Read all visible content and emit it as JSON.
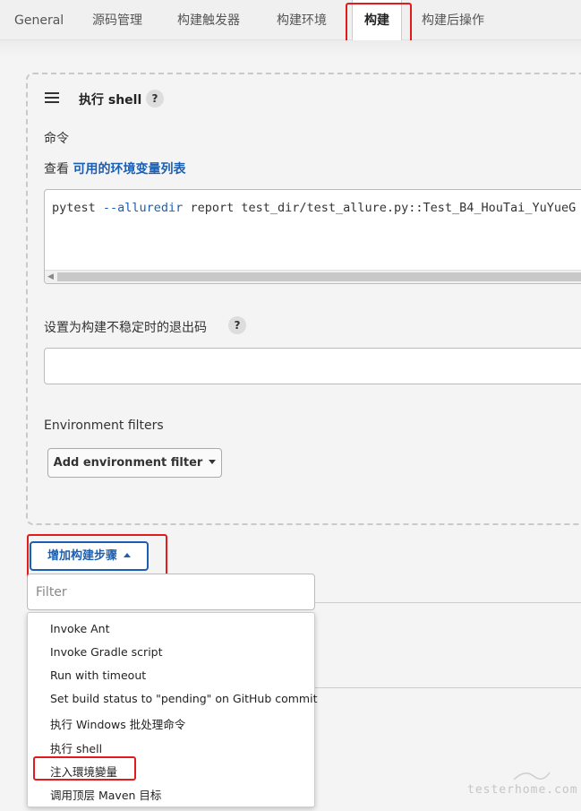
{
  "tabs": [
    "General",
    "源码管理",
    "构建触发器",
    "构建环境",
    "构建",
    "构建后操作"
  ],
  "active_tab": "构建",
  "step": {
    "title": "执行 shell",
    "help": "?",
    "command_label": "命令",
    "view_prefix": "查看",
    "env_link": "可用的环境变量列表",
    "command_prefix": "pytest ",
    "command_keyword": "--alluredir",
    "command_rest": " report test_dir/test_allure.py::Test_B4_HouTai_YuYueG",
    "exit_code_label": "设置为构建不稳定时的退出码",
    "exit_code_value": "",
    "env_filters_label": "Environment filters",
    "add_env_filter_button": "Add environment filter"
  },
  "add_step_button": "增加构建步骤",
  "filter": {
    "placeholder": "Filter",
    "value": ""
  },
  "menu_items": [
    "Invoke Ant",
    "Invoke Gradle script",
    "Run with timeout",
    "Set build status to \"pending\" on GitHub commit",
    "执行 Windows 批处理命令",
    "执行 shell",
    "注入環境變量",
    "调用顶层 Maven 目标"
  ],
  "watermark": "testerhome.com",
  "colors": {
    "highlight": "#e21c1c",
    "link": "#1a5fb4",
    "background": "#f4f4f4"
  }
}
